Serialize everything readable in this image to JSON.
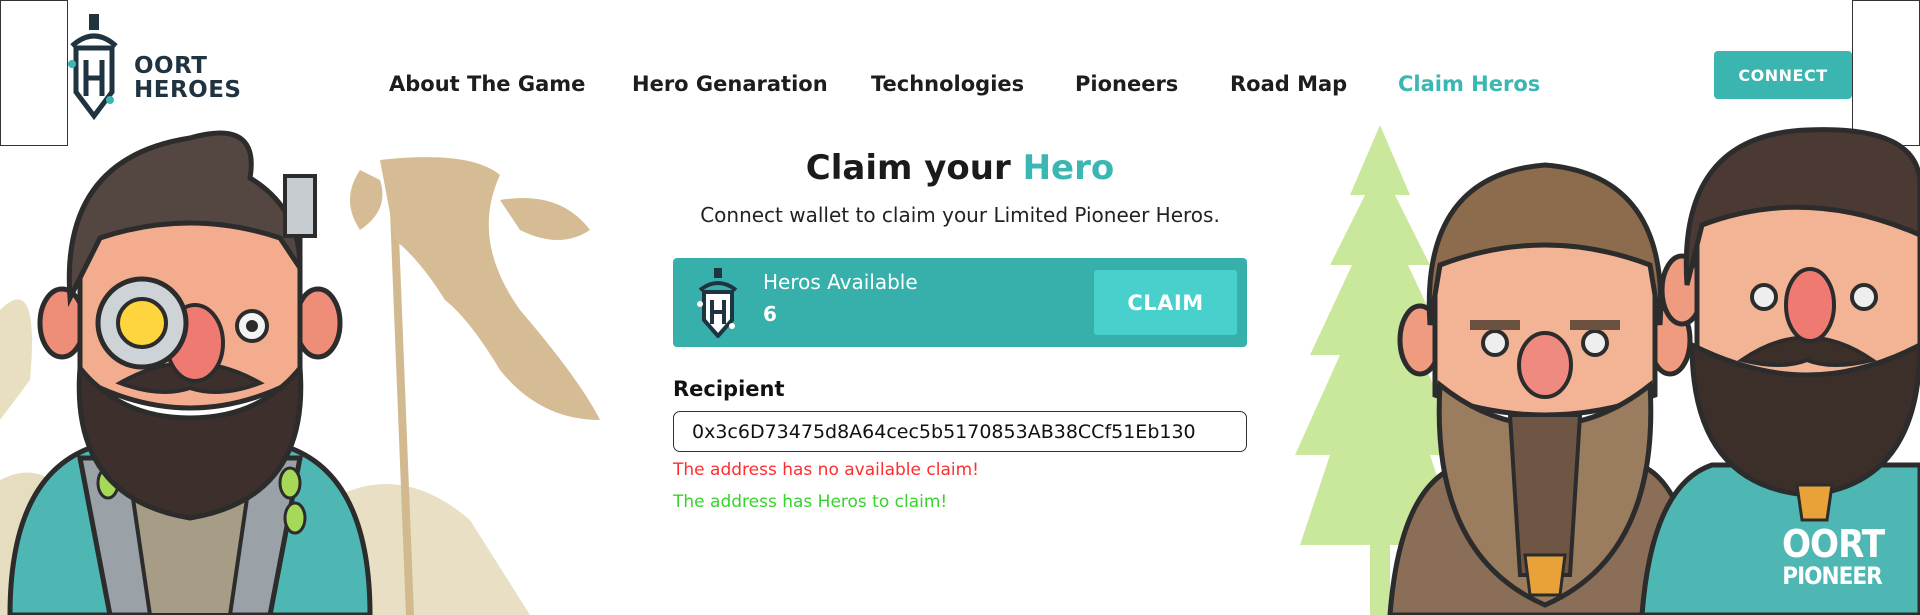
{
  "brand": {
    "line1": "OORT",
    "line2": "HEROES"
  },
  "nav": {
    "items": [
      {
        "label": "About The Game"
      },
      {
        "label": "Hero Genaration"
      },
      {
        "label": "Technologies"
      },
      {
        "label": "Pioneers"
      },
      {
        "label": "Road Map"
      },
      {
        "label": "Claim Heros"
      }
    ],
    "active_index": 5
  },
  "header": {
    "connect_label": "CONNECT"
  },
  "hero": {
    "title_prefix": "Claim your",
    "title_accent": "Hero",
    "subtitle": "Connect wallet to claim your Limited Pioneer Heros."
  },
  "claim_card": {
    "label": "Heros Available",
    "count": "6",
    "button_label": "CLAIM"
  },
  "recipient": {
    "label": "Recipient",
    "value": "0x3c6D73475d8A64cec5b5170853AB38CCf51Eb130"
  },
  "messages": {
    "error": "The address has no available claim!",
    "success": "The address has Heros to claim!"
  },
  "shirt_badge": {
    "line1": "OORT",
    "line2": "PIONEER"
  },
  "colors": {
    "accent": "#3ab7b2",
    "card": "#37b0ab",
    "error": "#ff2d2d",
    "success": "#36d42b"
  }
}
